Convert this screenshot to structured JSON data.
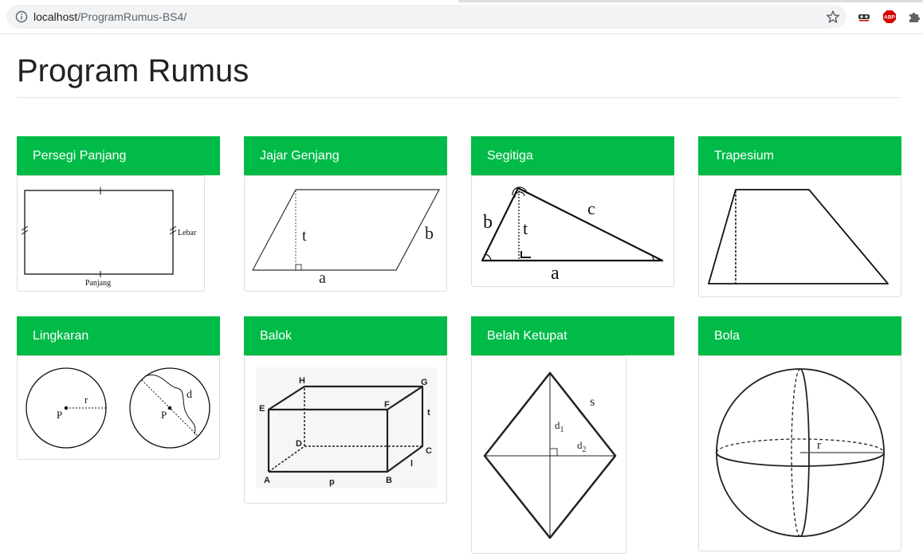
{
  "browser": {
    "url_host": "localhost",
    "url_path": "/ProgramRumus-BS4/",
    "icons": [
      "info-icon",
      "star-icon",
      "incognito-extension-icon",
      "adblock-plus-icon",
      "extensions-puzzle-icon"
    ],
    "abp_label": "ABP"
  },
  "page": {
    "title": "Program Rumus"
  },
  "colors": {
    "header_green": "#00bb48",
    "header_text": "#ffffff",
    "title_text": "#222222"
  },
  "cards": [
    {
      "title": "Persegi Panjang",
      "labels": {
        "width": "Lebar",
        "length": "Panjang"
      }
    },
    {
      "title": "Jajar Genjang",
      "labels": {
        "height": "t",
        "side": "b",
        "base": "a"
      }
    },
    {
      "title": "Segitiga",
      "labels": {
        "left": "b",
        "height": "t",
        "right": "c",
        "base": "a"
      }
    },
    {
      "title": "Trapesium"
    },
    {
      "title": "Lingkaran",
      "labels": {
        "radius": "r",
        "center1": "P",
        "diameter": "d",
        "center2": "P"
      }
    },
    {
      "title": "Balok",
      "labels": {
        "H": "H",
        "G": "G",
        "E": "E",
        "F": "F",
        "D": "D",
        "C": "C",
        "A": "A",
        "B": "B",
        "t": "t",
        "l": "l",
        "p": "p"
      }
    },
    {
      "title": "Belah Ketupat",
      "labels": {
        "side": "s",
        "d1": "d",
        "d1_sub": "1",
        "d2": "d",
        "d2_sub": "2"
      }
    },
    {
      "title": "Bola",
      "labels": {
        "radius": "r"
      }
    }
  ]
}
